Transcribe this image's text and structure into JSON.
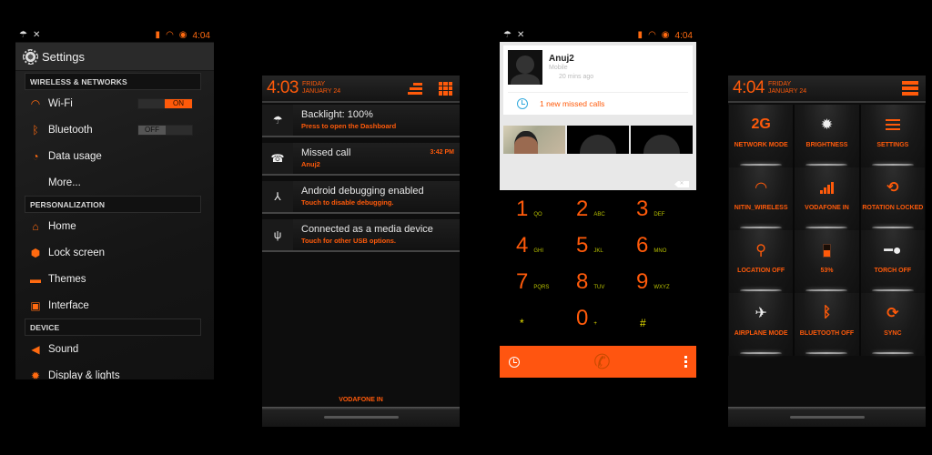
{
  "status_bar": {
    "time": "4:04",
    "left_icons": [
      "umbrella-icon",
      "missed-call-icon"
    ],
    "right_icons": [
      "vibrate-icon",
      "wifi-icon",
      "signal-icon",
      "battery-circle-icon"
    ]
  },
  "settings_screen": {
    "title": "Settings",
    "sections": [
      {
        "header": "WIRELESS & NETWORKS",
        "items": [
          {
            "label": "Wi-Fi",
            "icon": "wifi-icon",
            "toggle": "ON"
          },
          {
            "label": "Bluetooth",
            "icon": "bluetooth-icon",
            "toggle": "OFF"
          },
          {
            "label": "Data usage",
            "icon": "data-usage-icon"
          },
          {
            "label": "More..."
          }
        ]
      },
      {
        "header": "PERSONALIZATION",
        "items": [
          {
            "label": "Home",
            "icon": "home-icon"
          },
          {
            "label": "Lock screen",
            "icon": "lock-icon"
          },
          {
            "label": "Themes",
            "icon": "themes-icon"
          },
          {
            "label": "Interface",
            "icon": "interface-icon"
          }
        ]
      },
      {
        "header": "DEVICE",
        "items": [
          {
            "label": "Sound",
            "icon": "sound-icon"
          },
          {
            "label": "Display & lights",
            "icon": "display-icon"
          }
        ]
      }
    ]
  },
  "notification_screen": {
    "time": "4:03",
    "day": "FRIDAY",
    "date": "JANUARY 24",
    "notifications": [
      {
        "title": "Backlight: 100%",
        "subtitle": "Press to open the Dashboard",
        "icon": "umbrella-icon",
        "time": ""
      },
      {
        "title": "Missed call",
        "subtitle": "Anuj2",
        "icon": "missed-call-icon",
        "time": "3:42 PM"
      },
      {
        "title": "Android debugging enabled",
        "subtitle": "Touch to disable debugging.",
        "icon": "usb-debug-icon",
        "time": ""
      },
      {
        "title": "Connected as a media device",
        "subtitle": "Touch for other USB options.",
        "icon": "usb-icon",
        "time": ""
      }
    ],
    "carrier": "VODAFONE IN"
  },
  "dialer_screen": {
    "contact_name": "Anuj2",
    "contact_type": "Mobile",
    "contact_ago": "20 mins ago",
    "missed_calls": "1 new missed calls",
    "keys": [
      {
        "digit": "1",
        "letters": "QO"
      },
      {
        "digit": "2",
        "letters": "ABC"
      },
      {
        "digit": "3",
        "letters": "DEF"
      },
      {
        "digit": "4",
        "letters": "GHI"
      },
      {
        "digit": "5",
        "letters": "JKL"
      },
      {
        "digit": "6",
        "letters": "MNO"
      },
      {
        "digit": "7",
        "letters": "PQRS"
      },
      {
        "digit": "8",
        "letters": "TUV"
      },
      {
        "digit": "9",
        "letters": "WXYZ"
      },
      {
        "digit": "*",
        "letters": ""
      },
      {
        "digit": "0",
        "letters": "+"
      },
      {
        "digit": "#",
        "letters": ""
      }
    ]
  },
  "toggles_screen": {
    "time": "4:04",
    "day": "FRIDAY",
    "date": "JANUARY 24",
    "tiles": [
      {
        "label": "NETWORK MODE",
        "value": "2G",
        "icon": "network-mode-icon"
      },
      {
        "label": "BRIGHTNESS",
        "icon": "brightness-icon"
      },
      {
        "label": "SETTINGS",
        "icon": "settings-sliders-icon"
      },
      {
        "label": "NITIN_WIRELESS",
        "icon": "wifi-icon"
      },
      {
        "label": "VODAFONE IN",
        "icon": "signal-icon"
      },
      {
        "label": "ROTATION LOCKED",
        "icon": "rotation-lock-icon"
      },
      {
        "label": "LOCATION OFF",
        "icon": "location-icon"
      },
      {
        "label": "53%",
        "icon": "battery-icon",
        "battery_level": 0.53
      },
      {
        "label": "TORCH OFF",
        "icon": "torch-icon"
      },
      {
        "label": "AIRPLANE MODE",
        "icon": "airplane-icon"
      },
      {
        "label": "BLUETOOTH OFF",
        "icon": "bluetooth-icon"
      },
      {
        "label": "SYNC",
        "icon": "sync-icon"
      }
    ]
  },
  "colors": {
    "accent": "#ff5a0a",
    "dialbar": "#ff5510",
    "keypad_letters": "#b8c000"
  }
}
